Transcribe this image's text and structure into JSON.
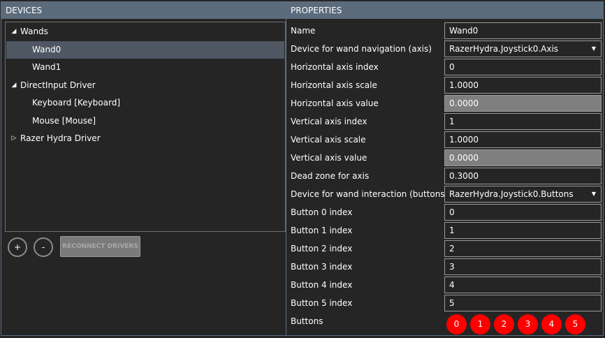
{
  "devices": {
    "header": "DEVICES",
    "tree": [
      {
        "label": "Wands",
        "arrow": "◢",
        "level": 0
      },
      {
        "label": "Wand0",
        "arrow": "",
        "level": 1,
        "selected": true
      },
      {
        "label": "Wand1",
        "arrow": "",
        "level": 1
      },
      {
        "label": "DirectInput Driver",
        "arrow": "◢",
        "level": 0
      },
      {
        "label": "Keyboard  [Keyboard]",
        "arrow": "",
        "level": 1
      },
      {
        "label": "Mouse  [Mouse]",
        "arrow": "",
        "level": 1
      },
      {
        "label": "Razer Hydra Driver",
        "arrow": "▷",
        "level": 0
      }
    ],
    "add_label": "+",
    "remove_label": "-",
    "reconnect_label": "RECONNECT DRIVERS"
  },
  "properties": {
    "header": "PROPERTIES",
    "rows": [
      {
        "label": "Name",
        "value": "Wand0",
        "kind": "text"
      },
      {
        "label": "Device for wand navigation (axis)",
        "value": "RazerHydra.Joystick0.Axis",
        "kind": "select"
      },
      {
        "label": "Horizontal axis index",
        "value": "0",
        "kind": "text"
      },
      {
        "label": "Horizontal axis scale",
        "value": "1.0000",
        "kind": "text"
      },
      {
        "label": "Horizontal axis value",
        "value": "0.0000",
        "kind": "readonly"
      },
      {
        "label": "Vertical axis index",
        "value": "1",
        "kind": "text"
      },
      {
        "label": "Vertical axis scale",
        "value": "1.0000",
        "kind": "text"
      },
      {
        "label": "Vertical axis value",
        "value": "0.0000",
        "kind": "readonly"
      },
      {
        "label": "Dead zone for axis",
        "value": "0.3000",
        "kind": "text"
      },
      {
        "label": "Device for wand interaction (buttons)",
        "value": "RazerHydra.Joystick0.Buttons",
        "kind": "select"
      },
      {
        "label": "Button 0 index",
        "value": "0",
        "kind": "text"
      },
      {
        "label": "Button 1 index",
        "value": "1",
        "kind": "text"
      },
      {
        "label": "Button 2 index",
        "value": "2",
        "kind": "text"
      },
      {
        "label": "Button 3 index",
        "value": "3",
        "kind": "text"
      },
      {
        "label": "Button 4 index",
        "value": "4",
        "kind": "text"
      },
      {
        "label": "Button 5 index",
        "value": "5",
        "kind": "text"
      }
    ],
    "buttons_label": "Buttons",
    "button_indicators": [
      "0",
      "1",
      "2",
      "3",
      "4",
      "5"
    ],
    "indicator_color": "#ff0000"
  },
  "colors": {
    "header_bg": "#5b6b7c",
    "panel_bg": "#252526",
    "selected_row": "#4e5762",
    "readonly_bg": "#7f7f7f"
  }
}
